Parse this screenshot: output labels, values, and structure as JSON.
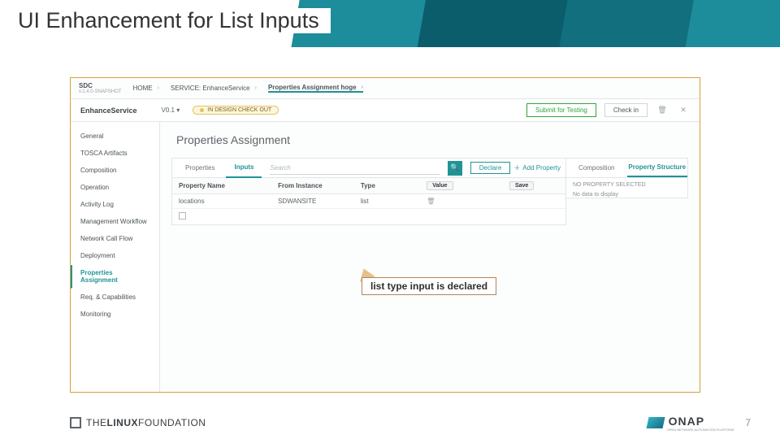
{
  "slide": {
    "title": "UI Enhancement for List Inputs",
    "callout": "list type input is declared",
    "page_number": "7"
  },
  "brand": {
    "l1": "SDC",
    "l2": "v.1.4.0-SNAPSHOT"
  },
  "breadcrumbs": {
    "home": "HOME",
    "service": "SERVICE: EnhanceService",
    "current": "Properties Assignment hoge"
  },
  "service_bar": {
    "name": "EnhanceService",
    "version": "V0.1 ▾",
    "status": "IN DESIGN CHECK OUT",
    "submit": "Submit for Testing",
    "checkin": "Check in"
  },
  "side_nav": {
    "items": [
      "General",
      "TOSCA Artifacts",
      "Composition",
      "Operation",
      "Activity Log",
      "Management Workflow",
      "Network Call Flow",
      "Deployment",
      "Properties Assignment",
      "Req. & Capabilities",
      "Monitoring"
    ],
    "active_index": 8
  },
  "page_heading": "Properties Assignment",
  "left_panel": {
    "tabs": {
      "properties": "Properties",
      "inputs": "Inputs"
    },
    "search_placeholder": "Search",
    "declare": "Declare",
    "add_property": "Add Property",
    "headers": {
      "name": "Property Name",
      "from": "From Instance",
      "type": "Type",
      "value_btn": "Value",
      "save_btn": "Save"
    },
    "row": {
      "name": "locations",
      "from": "SDWANSITE",
      "type": "list"
    }
  },
  "right_panel": {
    "tabs": {
      "comp": "Composition",
      "struct": "Property Structure"
    },
    "msg1": "NO PROPERTY SELECTED",
    "msg2": "No data to display"
  },
  "footer": {
    "lf1": "THE",
    "lf2": "LINUX",
    "lf3": "FOUNDATION",
    "onap": "ONAP",
    "onap_sub": "OPEN NETWORK AUTOMATION PLATFORM"
  }
}
